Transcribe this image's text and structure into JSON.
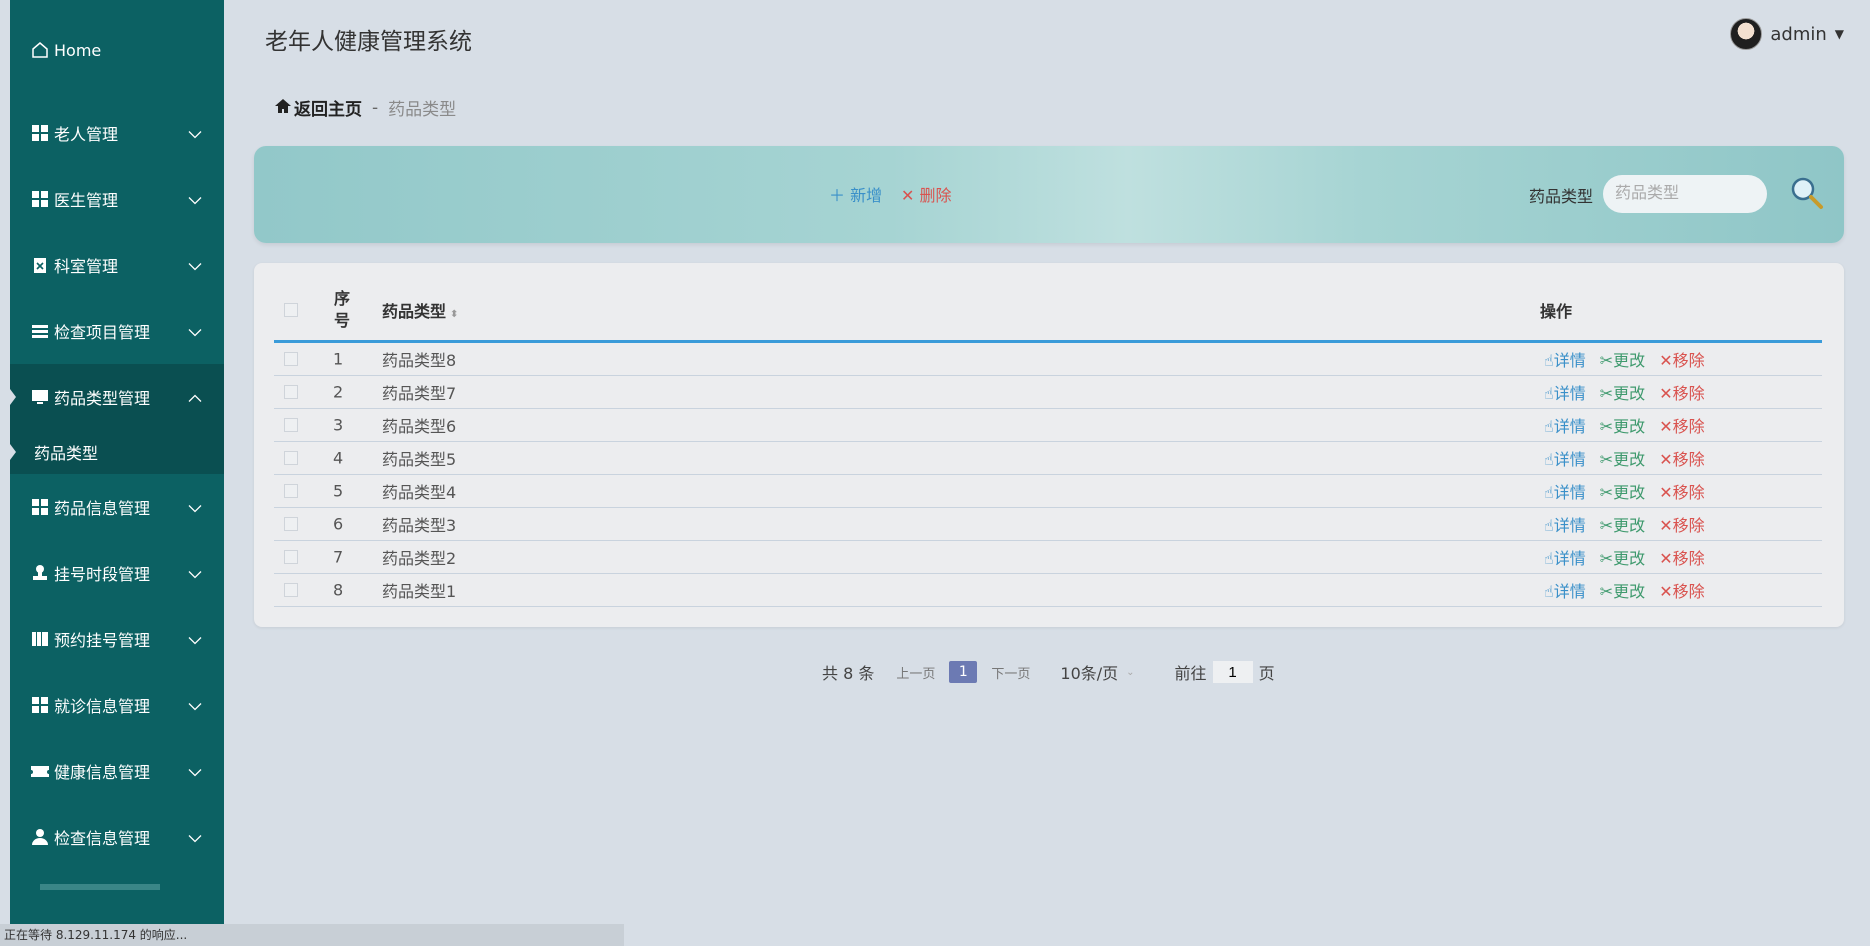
{
  "app": {
    "title": "老年人健康管理系统"
  },
  "user": {
    "name": "admin"
  },
  "sidebar": {
    "items": [
      {
        "label": "Home",
        "icon": "home-icon"
      },
      {
        "label": "老人管理",
        "icon": "grid-icon"
      },
      {
        "label": "医生管理",
        "icon": "grid-icon"
      },
      {
        "label": "科室管理",
        "icon": "clipboard-icon"
      },
      {
        "label": "检查项目管理",
        "icon": "list-icon"
      },
      {
        "label": "药品类型管理",
        "icon": "monitor-icon",
        "active": true
      },
      {
        "label": "药品类型",
        "sub": true
      },
      {
        "label": "药品信息管理",
        "icon": "grid-icon"
      },
      {
        "label": "挂号时段管理",
        "icon": "stamp-icon"
      },
      {
        "label": "预约挂号管理",
        "icon": "book-icon"
      },
      {
        "label": "就诊信息管理",
        "icon": "grid-icon"
      },
      {
        "label": "健康信息管理",
        "icon": "ticket-icon"
      },
      {
        "label": "检查信息管理",
        "icon": "user-icon"
      }
    ]
  },
  "breadcrumb": {
    "home": "返回主页",
    "sep": "-",
    "current": "药品类型"
  },
  "toolbar": {
    "add_label": "新增",
    "delete_label": "删除",
    "search_label": "药品类型",
    "search_placeholder": "药品类型"
  },
  "table": {
    "headers": {
      "index": "序号",
      "name": "药品类型",
      "ops": "操作"
    },
    "ops": {
      "detail": "详情",
      "edit": "更改",
      "remove": "移除"
    },
    "rows": [
      {
        "index": "1",
        "name": "药品类型8"
      },
      {
        "index": "2",
        "name": "药品类型7"
      },
      {
        "index": "3",
        "name": "药品类型6"
      },
      {
        "index": "4",
        "name": "药品类型5"
      },
      {
        "index": "5",
        "name": "药品类型4"
      },
      {
        "index": "6",
        "name": "药品类型3"
      },
      {
        "index": "7",
        "name": "药品类型2"
      },
      {
        "index": "8",
        "name": "药品类型1"
      }
    ]
  },
  "pagination": {
    "total": "共 8 条",
    "prev": "上一页",
    "current": "1",
    "next": "下一页",
    "page_size": "10条/页",
    "goto_prefix": "前往",
    "goto_value": "1",
    "goto_suffix": "页"
  },
  "status_bar": {
    "text": "正在等待 8.129.11.174 的响应..."
  },
  "colors": {
    "sidebar": "#0c6163",
    "sidebar_active": "#0a4f51",
    "accent": "#3a9bd9",
    "danger": "#d9534f"
  }
}
